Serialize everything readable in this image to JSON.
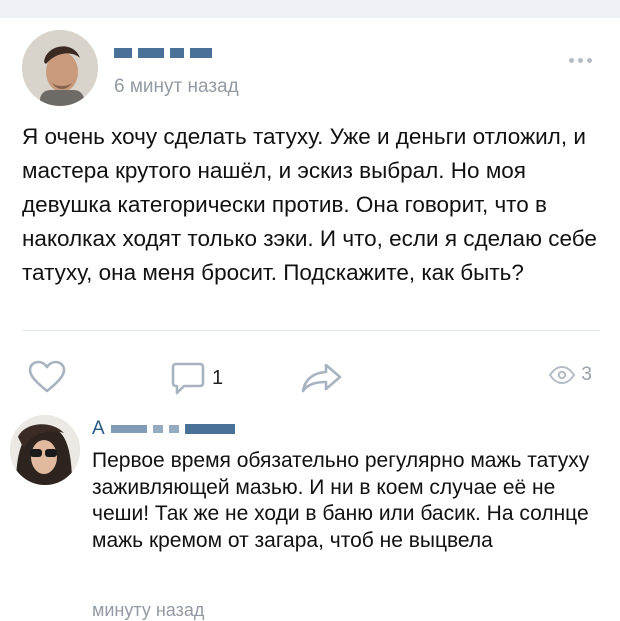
{
  "post": {
    "time": "6 минут назад",
    "text": "Я очень хочу сделать татуху. Уже и деньги отложил, и мастера крутого нашёл, и эскиз выбрал. Но моя девушка категорически против. Она говорит, что в наколках ходят только зэки. И что, если я сделаю себе татуху, она меня бросит. Подскажите, как быть?"
  },
  "actions": {
    "comments_count": "1",
    "views_count": "3"
  },
  "comment": {
    "author_initial": "А",
    "text": "Первое время обязательно регулярно мажь татуху заживляющей мазью. И ни в коем случае её не чеши! Так же не ходи в баню или басик. На солнце мажь кремом от загара, чтоб не выцвела",
    "time": "минуту назад"
  },
  "icons": {
    "like": "heart-icon",
    "comment": "comment-bubble-icon",
    "share": "share-arrow-icon",
    "views": "eye-icon",
    "more": "more-dots-icon"
  },
  "colors": {
    "link": "#2a5885",
    "muted": "#939aa3",
    "icon": "#aeb6c2"
  }
}
